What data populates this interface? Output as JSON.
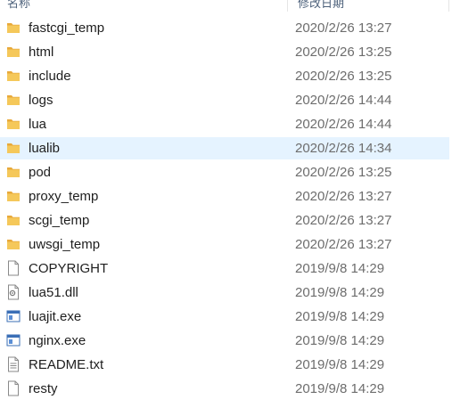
{
  "header": {
    "name_label": "名称",
    "date_label": "修改日期"
  },
  "files": [
    {
      "name": "fastcgi_temp",
      "date": "2020/2/26 13:27",
      "icon": "folder-icon"
    },
    {
      "name": "html",
      "date": "2020/2/26 13:25",
      "icon": "folder-icon"
    },
    {
      "name": "include",
      "date": "2020/2/26 13:25",
      "icon": "folder-icon"
    },
    {
      "name": "logs",
      "date": "2020/2/26 14:44",
      "icon": "folder-icon"
    },
    {
      "name": "lua",
      "date": "2020/2/26 14:44",
      "icon": "folder-icon"
    },
    {
      "name": "lualib",
      "date": "2020/2/26 14:34",
      "icon": "folder-icon",
      "selected": true
    },
    {
      "name": "pod",
      "date": "2020/2/26 13:25",
      "icon": "folder-icon"
    },
    {
      "name": "proxy_temp",
      "date": "2020/2/26 13:27",
      "icon": "folder-icon"
    },
    {
      "name": "scgi_temp",
      "date": "2020/2/26 13:27",
      "icon": "folder-icon"
    },
    {
      "name": "uwsgi_temp",
      "date": "2020/2/26 13:27",
      "icon": "folder-icon"
    },
    {
      "name": "COPYRIGHT",
      "date": "2019/9/8 14:29",
      "icon": "file-icon"
    },
    {
      "name": "lua51.dll",
      "date": "2019/9/8 14:29",
      "icon": "dll-file-icon"
    },
    {
      "name": "luajit.exe",
      "date": "2019/9/8 14:29",
      "icon": "exe-file-icon"
    },
    {
      "name": "nginx.exe",
      "date": "2019/9/8 14:29",
      "icon": "exe-file-icon"
    },
    {
      "name": "README.txt",
      "date": "2019/9/8 14:29",
      "icon": "text-file-icon"
    },
    {
      "name": "resty",
      "date": "2019/9/8 14:29",
      "icon": "file-icon"
    }
  ],
  "colors": {
    "folder": "#f2c14e",
    "selection": "#e5f3ff"
  }
}
